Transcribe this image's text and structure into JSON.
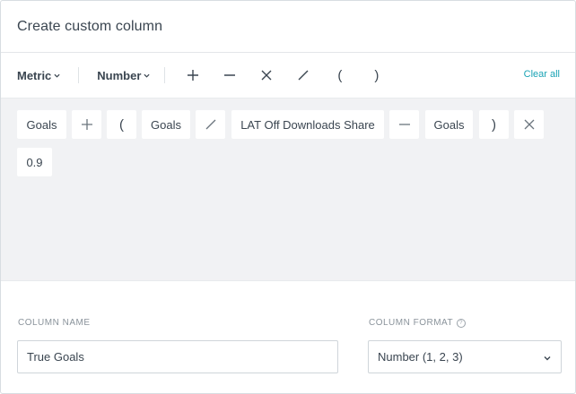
{
  "dialog": {
    "title": "Create custom column"
  },
  "toolbar": {
    "metric_label": "Metric",
    "number_label": "Number",
    "open_paren": "(",
    "close_paren": ")",
    "clear_all": "Clear all"
  },
  "formula": {
    "tokens": [
      "Goals",
      "+",
      "(",
      "Goals",
      "/",
      "LAT Off Downloads Share",
      "−",
      "Goals",
      ")",
      "×",
      "0.9"
    ]
  },
  "column_name": {
    "label": "COLUMN NAME",
    "value": "True Goals"
  },
  "column_format": {
    "label": "COLUMN FORMAT",
    "value": "Number (1, 2, 3)"
  }
}
